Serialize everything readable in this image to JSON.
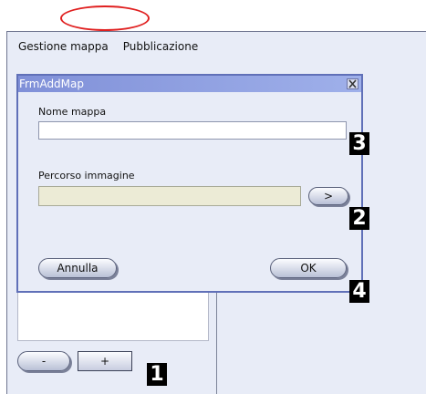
{
  "menu": {
    "items": [
      "Gestione mappa",
      "Pubblicazione"
    ]
  },
  "dialog": {
    "title": "FrmAddMap",
    "name_label": "Nome mappa",
    "name_value": "",
    "path_label": "Percorso immagine",
    "path_value": "",
    "browse_label": ">",
    "cancel_label": "Annulla",
    "ok_label": "OK"
  },
  "main": {
    "minus_label": "-",
    "plus_label": "+"
  },
  "annotations": [
    "1",
    "2",
    "3",
    "4"
  ],
  "colors": {
    "highlight_ellipse": "#e02020",
    "titlebar": "#8090d8",
    "window_bg": "#e8ecf7"
  },
  "icons": {
    "close": "close-x-icon"
  }
}
